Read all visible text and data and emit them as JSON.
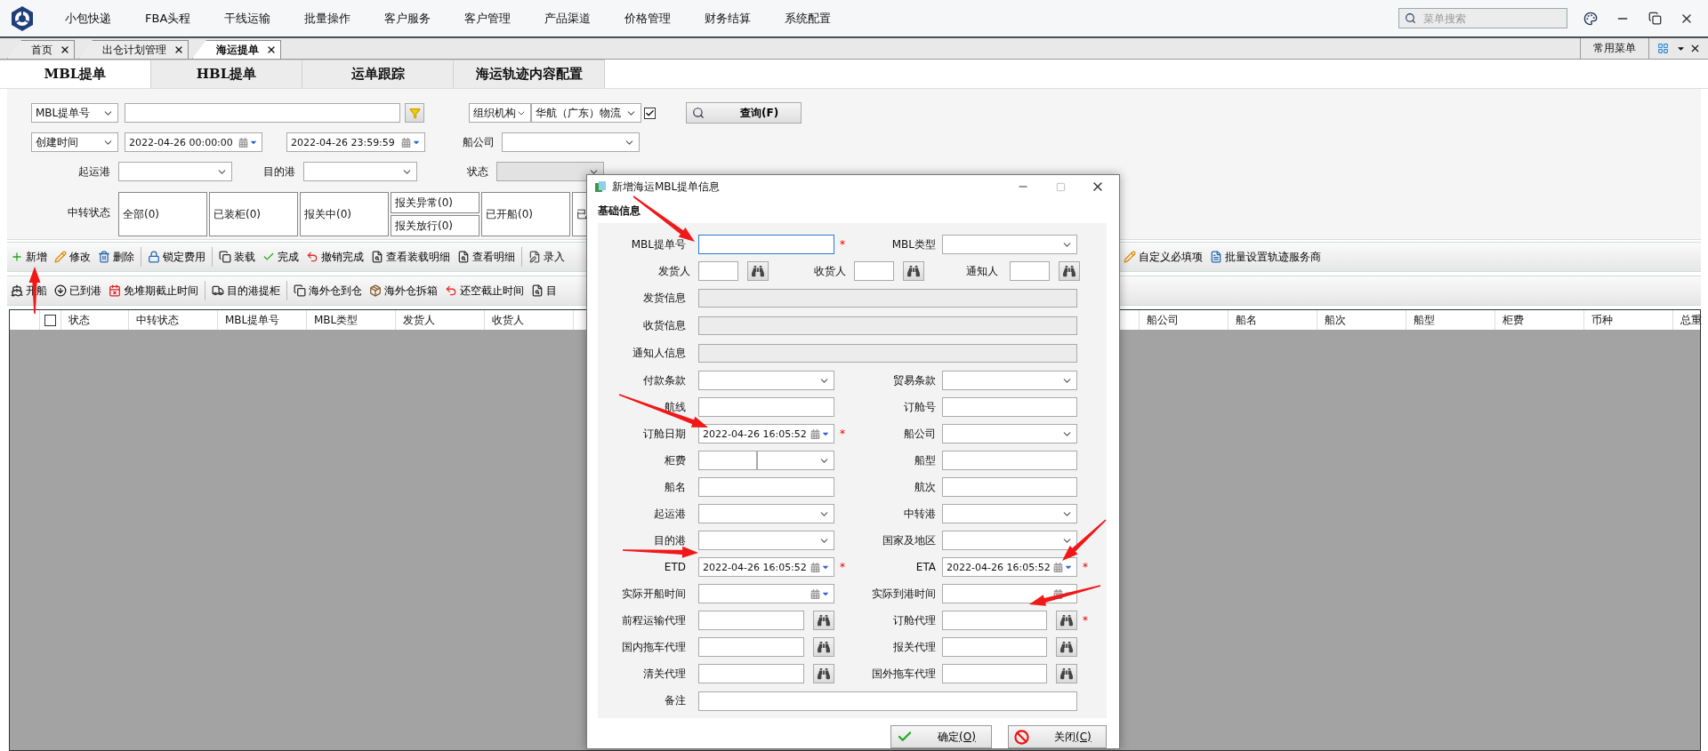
{
  "menu_bar": {
    "items": [
      "小包快递",
      "FBA头程",
      "干线运输",
      "批量操作",
      "客户服务",
      "客户管理",
      "产品渠道",
      "价格管理",
      "财务结算",
      "系统配置"
    ],
    "search": {
      "placeholder": "菜单搜索"
    }
  },
  "doc_tabs": [
    {
      "label": "首页",
      "selected": false
    },
    {
      "label": "出仓计划管理",
      "selected": false
    },
    {
      "label": "海运提单",
      "selected": true
    }
  ],
  "favorites": {
    "label": "常用菜单"
  },
  "sub_tabs": [
    {
      "label": "MBL提单",
      "selected": true
    },
    {
      "label": "HBL提单",
      "selected": false
    },
    {
      "label": "运单跟踪",
      "selected": false
    },
    {
      "label": "海运轨迹内容配置",
      "selected": false
    }
  ],
  "filters": {
    "key_field": "MBL提单号",
    "org": {
      "label": "组织机构",
      "value": "华航（广东）物流",
      "checked": true
    },
    "query_button": "查询(F)",
    "time_field": "创建时间",
    "date_from": "2022-04-26 00:00:00",
    "date_to": "2022-04-26 23:59:59",
    "carrier_label": "船公司",
    "origin_label": "起运港",
    "destination_label": "目的港",
    "status": {
      "label": "状态",
      "disabled": true
    },
    "transit": {
      "label": "中转状态",
      "options": [
        {
          "kind": "single",
          "label": "全部(0)"
        },
        {
          "kind": "single",
          "label": "已装柜(0)"
        },
        {
          "kind": "single",
          "label": "报关中(0)"
        },
        {
          "kind": "stacked",
          "labels": [
            "报关异常(0)",
            "报关放行(0)"
          ]
        },
        {
          "kind": "single",
          "label": "已开船(0)"
        },
        {
          "kind": "single",
          "label": "已"
        }
      ]
    }
  },
  "toolbar_1": {
    "groups": [
      [
        "新增",
        "修改",
        "删除"
      ],
      [
        "锁定费用"
      ],
      [
        "装载",
        "完成",
        "撤销完成",
        "查看装载明细",
        "查看明细"
      ],
      [
        "录入"
      ]
    ],
    "right": [
      "自定义必填项",
      "批量设置轨迹服务商"
    ]
  },
  "toolbar_2": {
    "groups": [
      [
        "开船",
        "已到港",
        "免堆期截止时间"
      ],
      [
        "目的港提柜"
      ],
      [
        "海外仓到仓",
        "海外仓拆箱",
        "还空截止时间",
        "目"
      ]
    ]
  },
  "table": {
    "select_all": {
      "checked": false
    },
    "columns_left": [
      "状态",
      "中转状态",
      "MBL提单号",
      "MBL类型",
      "发货人",
      "收货人"
    ],
    "columns_right": [
      "船公司",
      "船名",
      "船次",
      "船型",
      "柜费",
      "币种",
      "总重"
    ]
  },
  "dialog": {
    "title": "新增海运MBL提单信息",
    "section": "基础信息",
    "required_mark": "*",
    "rows": [
      {
        "kind": "pair",
        "cells": [
          {
            "label": "MBL提单号",
            "kind": "text",
            "required": true,
            "focused": true
          },
          {
            "label": "MBL类型",
            "kind": "select"
          }
        ]
      },
      {
        "kind": "triple",
        "cells": [
          {
            "label": "发货人",
            "kind": "lookup"
          },
          {
            "label": "收货人",
            "kind": "lookup"
          },
          {
            "label": "通知人",
            "kind": "lookup"
          }
        ]
      },
      {
        "kind": "wide",
        "cells": [
          {
            "label": "发货信息",
            "kind": "readonly"
          }
        ]
      },
      {
        "kind": "wide",
        "cells": [
          {
            "label": "收货信息",
            "kind": "readonly"
          }
        ]
      },
      {
        "kind": "wide",
        "cells": [
          {
            "label": "通知人信息",
            "kind": "readonly"
          }
        ]
      },
      {
        "kind": "pair",
        "cells": [
          {
            "label": "付款条款",
            "kind": "select"
          },
          {
            "label": "贸易条款",
            "kind": "select"
          }
        ]
      },
      {
        "kind": "pair",
        "cells": [
          {
            "label": "航线",
            "kind": "text"
          },
          {
            "label": "订舱号",
            "kind": "text"
          }
        ]
      },
      {
        "kind": "pair",
        "cells": [
          {
            "label": "订舱日期",
            "kind": "date",
            "value": "2022-04-26 16:05:52",
            "required": true
          },
          {
            "label": "船公司",
            "kind": "select"
          }
        ]
      },
      {
        "kind": "pair",
        "cells": [
          {
            "label": "柜费",
            "kind": "split"
          },
          {
            "label": "船型",
            "kind": "text"
          }
        ]
      },
      {
        "kind": "pair",
        "cells": [
          {
            "label": "船名",
            "kind": "text"
          },
          {
            "label": "航次",
            "kind": "text"
          }
        ]
      },
      {
        "kind": "pair",
        "cells": [
          {
            "label": "起运港",
            "kind": "select"
          },
          {
            "label": "中转港",
            "kind": "select"
          }
        ]
      },
      {
        "kind": "pair",
        "cells": [
          {
            "label": "目的港",
            "kind": "select"
          },
          {
            "label": "国家及地区",
            "kind": "select"
          }
        ]
      },
      {
        "kind": "pair",
        "cells": [
          {
            "label": "ETD",
            "kind": "date",
            "value": "2022-04-26 16:05:52",
            "required": true
          },
          {
            "label": "ETA",
            "kind": "date",
            "value": "2022-04-26 16:05:52",
            "required": true
          }
        ]
      },
      {
        "kind": "pair",
        "cells": [
          {
            "label": "实际开船时间",
            "kind": "date"
          },
          {
            "label": "实际到港时间",
            "kind": "date"
          }
        ]
      },
      {
        "kind": "pair",
        "cells": [
          {
            "label": "前程运输代理",
            "kind": "lookup"
          },
          {
            "label": "订舱代理",
            "kind": "lookup",
            "required": true
          }
        ]
      },
      {
        "kind": "pair",
        "cells": [
          {
            "label": "国内拖车代理",
            "kind": "lookup"
          },
          {
            "label": "报关代理",
            "kind": "lookup"
          }
        ]
      },
      {
        "kind": "pair",
        "cells": [
          {
            "label": "清关代理",
            "kind": "lookup"
          },
          {
            "label": "国外拖车代理",
            "kind": "lookup"
          }
        ]
      },
      {
        "kind": "wide",
        "cells": [
          {
            "label": "备注",
            "kind": "memo"
          }
        ]
      }
    ],
    "buttons": [
      {
        "kind": "ok",
        "label": "确定",
        "key": "(O)"
      },
      {
        "kind": "close",
        "label": "关闭",
        "key": "(C)"
      }
    ]
  }
}
